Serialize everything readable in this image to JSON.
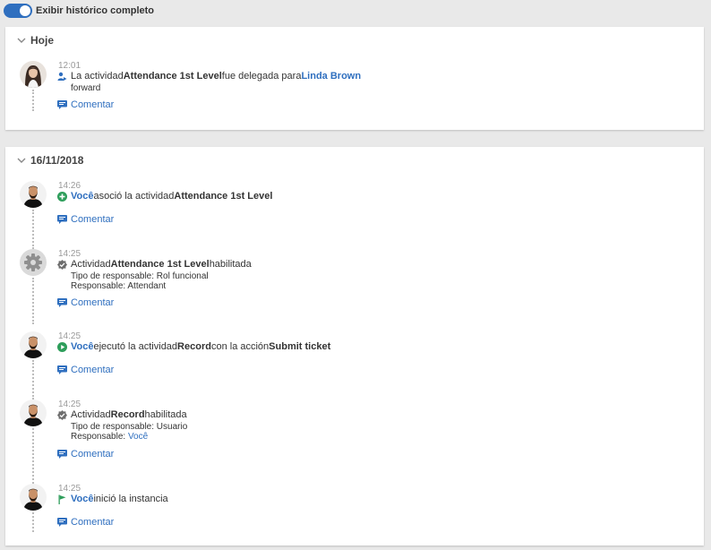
{
  "toggle": {
    "label": "Exibir histórico completo",
    "on": true
  },
  "colors": {
    "accent": "#2f6fbf",
    "green": "#2e9e5b",
    "grey": "#6d6d6d"
  },
  "sections": [
    {
      "title": "Hoje",
      "entries": [
        {
          "time": "12:01",
          "icon": "delegate-icon",
          "text": {
            "pre": "La actividad ",
            "activity": "Attendance 1st Level",
            "mid": " fue delegada para ",
            "user": "Linda Brown"
          },
          "details": [
            "forward"
          ],
          "comment": "Comentar"
        }
      ]
    },
    {
      "title": "16/11/2018",
      "entries": [
        {
          "time": "14:26",
          "icon": "plus-circle-icon",
          "text": {
            "user": "Você",
            "mid": " asoció la actividad ",
            "activity": "Attendance 1st Level"
          },
          "comment": "Comentar"
        },
        {
          "time": "14:25",
          "icon": "check-badge-icon",
          "text": {
            "pre": "Actividad ",
            "activity": "Attendance 1st Level",
            "post": " habilitada"
          },
          "details": [
            "Tipo de responsable: Rol funcional",
            "Responsable: Attendant"
          ],
          "comment": "Comentar"
        },
        {
          "time": "14:25",
          "icon": "play-circle-icon",
          "text": {
            "user": "Você",
            "mid": " ejecutó la actividad ",
            "activity": "Record",
            "mid2": " con la acción ",
            "action": "Submit ticket"
          },
          "comment": "Comentar"
        },
        {
          "time": "14:25",
          "icon": "check-badge-icon",
          "text": {
            "pre": "Actividad ",
            "activity": "Record",
            "post": " habilitada"
          },
          "details": [
            "Tipo de responsable: Usuario",
            "Responsable: "
          ],
          "details_link": "Você",
          "comment": "Comentar"
        },
        {
          "time": "14:25",
          "icon": "flag-icon",
          "text": {
            "user": "Você",
            "mid": " inició la instancia"
          },
          "comment": "Comentar"
        }
      ]
    }
  ]
}
